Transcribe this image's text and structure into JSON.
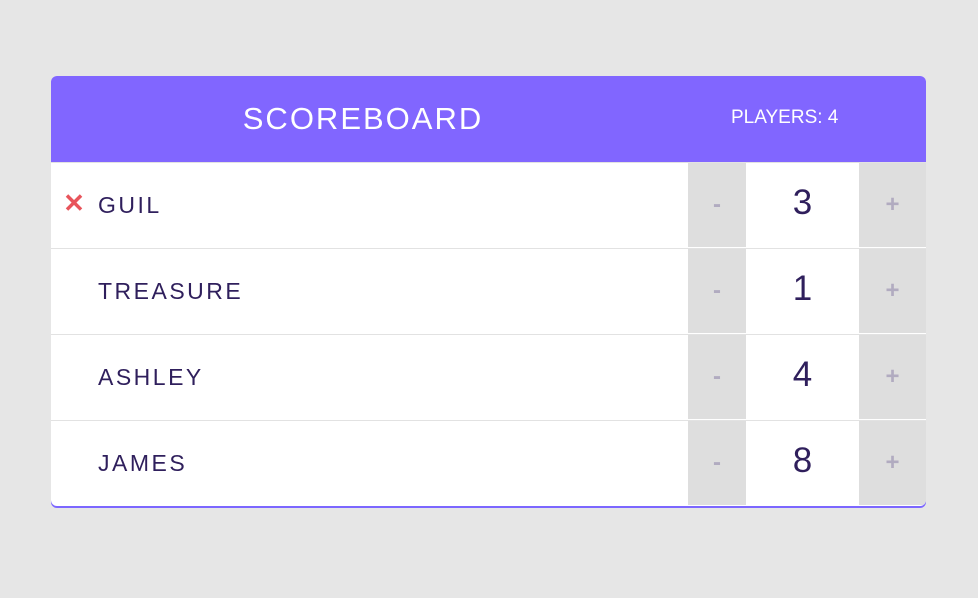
{
  "header": {
    "title": "SCOREBOARD",
    "players_label": "PLAYERS: 4"
  },
  "controls": {
    "remove_glyph": "✕",
    "decrement_label": "-",
    "increment_label": "+"
  },
  "players": [
    {
      "name": "GUIL",
      "score": "3",
      "show_remove": true
    },
    {
      "name": "TREASURE",
      "score": "1",
      "show_remove": false
    },
    {
      "name": "ASHLEY",
      "score": "4",
      "show_remove": false
    },
    {
      "name": "JAMES",
      "score": "8",
      "show_remove": false
    }
  ],
  "colors": {
    "header_bg": "#8166ff",
    "remove": "#e8545b",
    "text": "#2f1f5c",
    "button_bg": "#dedede",
    "button_text": "#b1abc0",
    "page_bg": "#e6e6e6"
  }
}
